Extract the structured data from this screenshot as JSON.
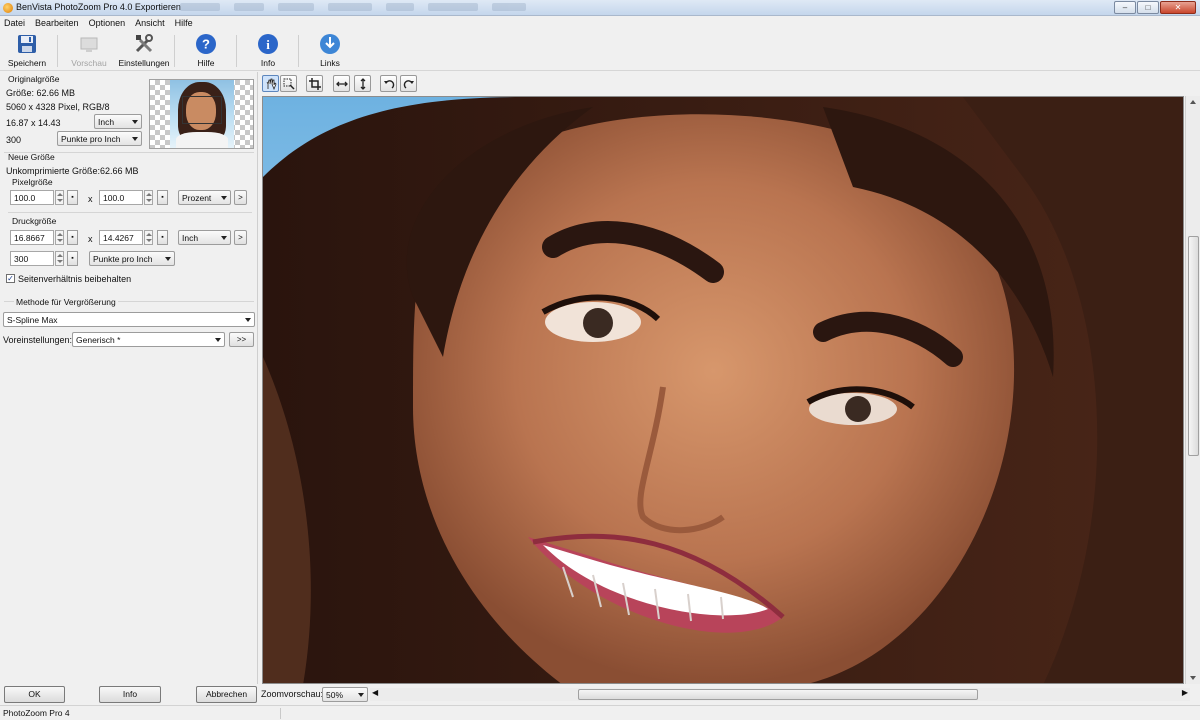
{
  "window": {
    "title": "BenVista PhotoZoom Pro 4.0 Exportieren"
  },
  "menu": [
    "Datei",
    "Bearbeiten",
    "Optionen",
    "Ansicht",
    "Hilfe"
  ],
  "toolbar": {
    "save": "Speichern",
    "preview": "Vorschau",
    "settings": "Einstellungen",
    "help": "Hilfe",
    "info": "Info",
    "links": "Links"
  },
  "original": {
    "title": "Originalgröße",
    "size": "Größe: 62.66 MB",
    "pixels": "5060 x 4328 Pixel, RGB/8",
    "dims": "16.87 x 14.43",
    "unit": "Inch",
    "dpi": "300",
    "res_unit": "Punkte pro Inch"
  },
  "newsize": {
    "title": "Neue Größe",
    "uncompressed": "Unkomprimierte Größe:62.66 MB",
    "pixel_title": "Pixelgröße",
    "pixel_w": "100.0",
    "pixel_h": "100.0",
    "pixel_unit": "Prozent",
    "x_sep": "x",
    "print_title": "Druckgröße",
    "print_w": "16.8667",
    "print_h": "14.4267",
    "print_unit": "Inch",
    "print_dpi": "300",
    "print_res_unit": "Punkte pro Inch",
    "keep_ratio": "Seitenverhältnis beibehalten",
    "keep_ratio_checked": true
  },
  "method": {
    "title": "Methode für Vergrößerung",
    "value": "S-Spline Max",
    "presets_label": "Voreinstellungen:",
    "presets_value": "Generisch *",
    "more": ">>"
  },
  "go": ">",
  "buttons": {
    "ok": "OK",
    "info": "Info",
    "cancel": "Abbrechen"
  },
  "zoom": {
    "label": "Zoomvorschau:",
    "value": "50%"
  },
  "status": "PhotoZoom Pro 4"
}
